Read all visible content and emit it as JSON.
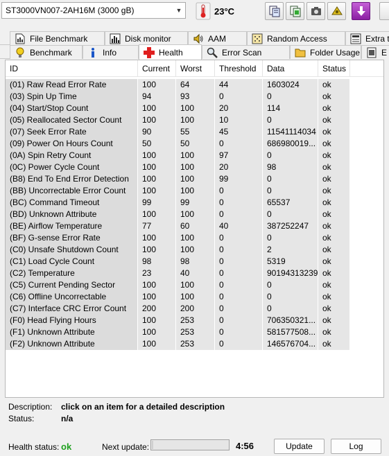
{
  "toolbar": {
    "drive": "ST3000VN007-2AH16M (3000 gB)",
    "temperature": "23°C",
    "buttons": [
      "copy-info-icon",
      "copy-report-icon",
      "screenshot-icon",
      "options-icon",
      "save-icon"
    ]
  },
  "tabs": {
    "row1": [
      "File Benchmark",
      "Disk monitor",
      "AAM",
      "Random Access",
      "Extra te"
    ],
    "row2": [
      "Benchmark",
      "Info",
      "Health",
      "Error Scan",
      "Folder Usage",
      "E"
    ],
    "active": "Health"
  },
  "grid": {
    "columns": [
      "ID",
      "Current",
      "Worst",
      "Threshold",
      "Data",
      "Status"
    ],
    "rows": [
      [
        "(01) Raw Read Error Rate",
        "100",
        "64",
        "44",
        "1603024",
        "ok"
      ],
      [
        "(03) Spin Up Time",
        "94",
        "93",
        "0",
        "0",
        "ok"
      ],
      [
        "(04) Start/Stop Count",
        "100",
        "100",
        "20",
        "114",
        "ok"
      ],
      [
        "(05) Reallocated Sector Count",
        "100",
        "100",
        "10",
        "0",
        "ok"
      ],
      [
        "(07) Seek Error Rate",
        "90",
        "55",
        "45",
        "11541114034",
        "ok"
      ],
      [
        "(09) Power On Hours Count",
        "50",
        "50",
        "0",
        "686980019...",
        "ok"
      ],
      [
        "(0A) Spin Retry Count",
        "100",
        "100",
        "97",
        "0",
        "ok"
      ],
      [
        "(0C) Power Cycle Count",
        "100",
        "100",
        "20",
        "98",
        "ok"
      ],
      [
        "(B8) End To End Error Detection",
        "100",
        "100",
        "99",
        "0",
        "ok"
      ],
      [
        "(BB) Uncorrectable Error Count",
        "100",
        "100",
        "0",
        "0",
        "ok"
      ],
      [
        "(BC) Command Timeout",
        "99",
        "99",
        "0",
        "65537",
        "ok"
      ],
      [
        "(BD) Unknown Attribute",
        "100",
        "100",
        "0",
        "0",
        "ok"
      ],
      [
        "(BE) Airflow Temperature",
        "77",
        "60",
        "40",
        "387252247",
        "ok"
      ],
      [
        "(BF) G-sense Error Rate",
        "100",
        "100",
        "0",
        "0",
        "ok"
      ],
      [
        "(C0) Unsafe Shutdown Count",
        "100",
        "100",
        "0",
        "2",
        "ok"
      ],
      [
        "(C1) Load Cycle Count",
        "98",
        "98",
        "0",
        "5319",
        "ok"
      ],
      [
        "(C2) Temperature",
        "23",
        "40",
        "0",
        "90194313239",
        "ok"
      ],
      [
        "(C5) Current Pending Sector",
        "100",
        "100",
        "0",
        "0",
        "ok"
      ],
      [
        "(C6) Offline Uncorrectable",
        "100",
        "100",
        "0",
        "0",
        "ok"
      ],
      [
        "(C7) Interface CRC Error Count",
        "200",
        "200",
        "0",
        "0",
        "ok"
      ],
      [
        "(F0) Head Flying Hours",
        "100",
        "253",
        "0",
        "706350321...",
        "ok"
      ],
      [
        "(F1) Unknown Attribute",
        "100",
        "253",
        "0",
        "581577508...",
        "ok"
      ],
      [
        "(F2) Unknown Attribute",
        "100",
        "253",
        "0",
        "146576704...",
        "ok"
      ]
    ]
  },
  "description": {
    "label": "Description:",
    "value": "click on an item for a detailed description",
    "status_label": "Status:",
    "status_value": "n/a"
  },
  "footer": {
    "health_label": "Health status:",
    "health_value": "ok",
    "next_update_label": "Next update:",
    "next_update_progress": 0.02,
    "countdown": "4:56",
    "update_button": "Update",
    "log_button": "Log"
  },
  "colors": {
    "ok_green": "#1ea01e",
    "cell_gray": "#e6e6e6",
    "purple_button": "#9b2db0"
  }
}
